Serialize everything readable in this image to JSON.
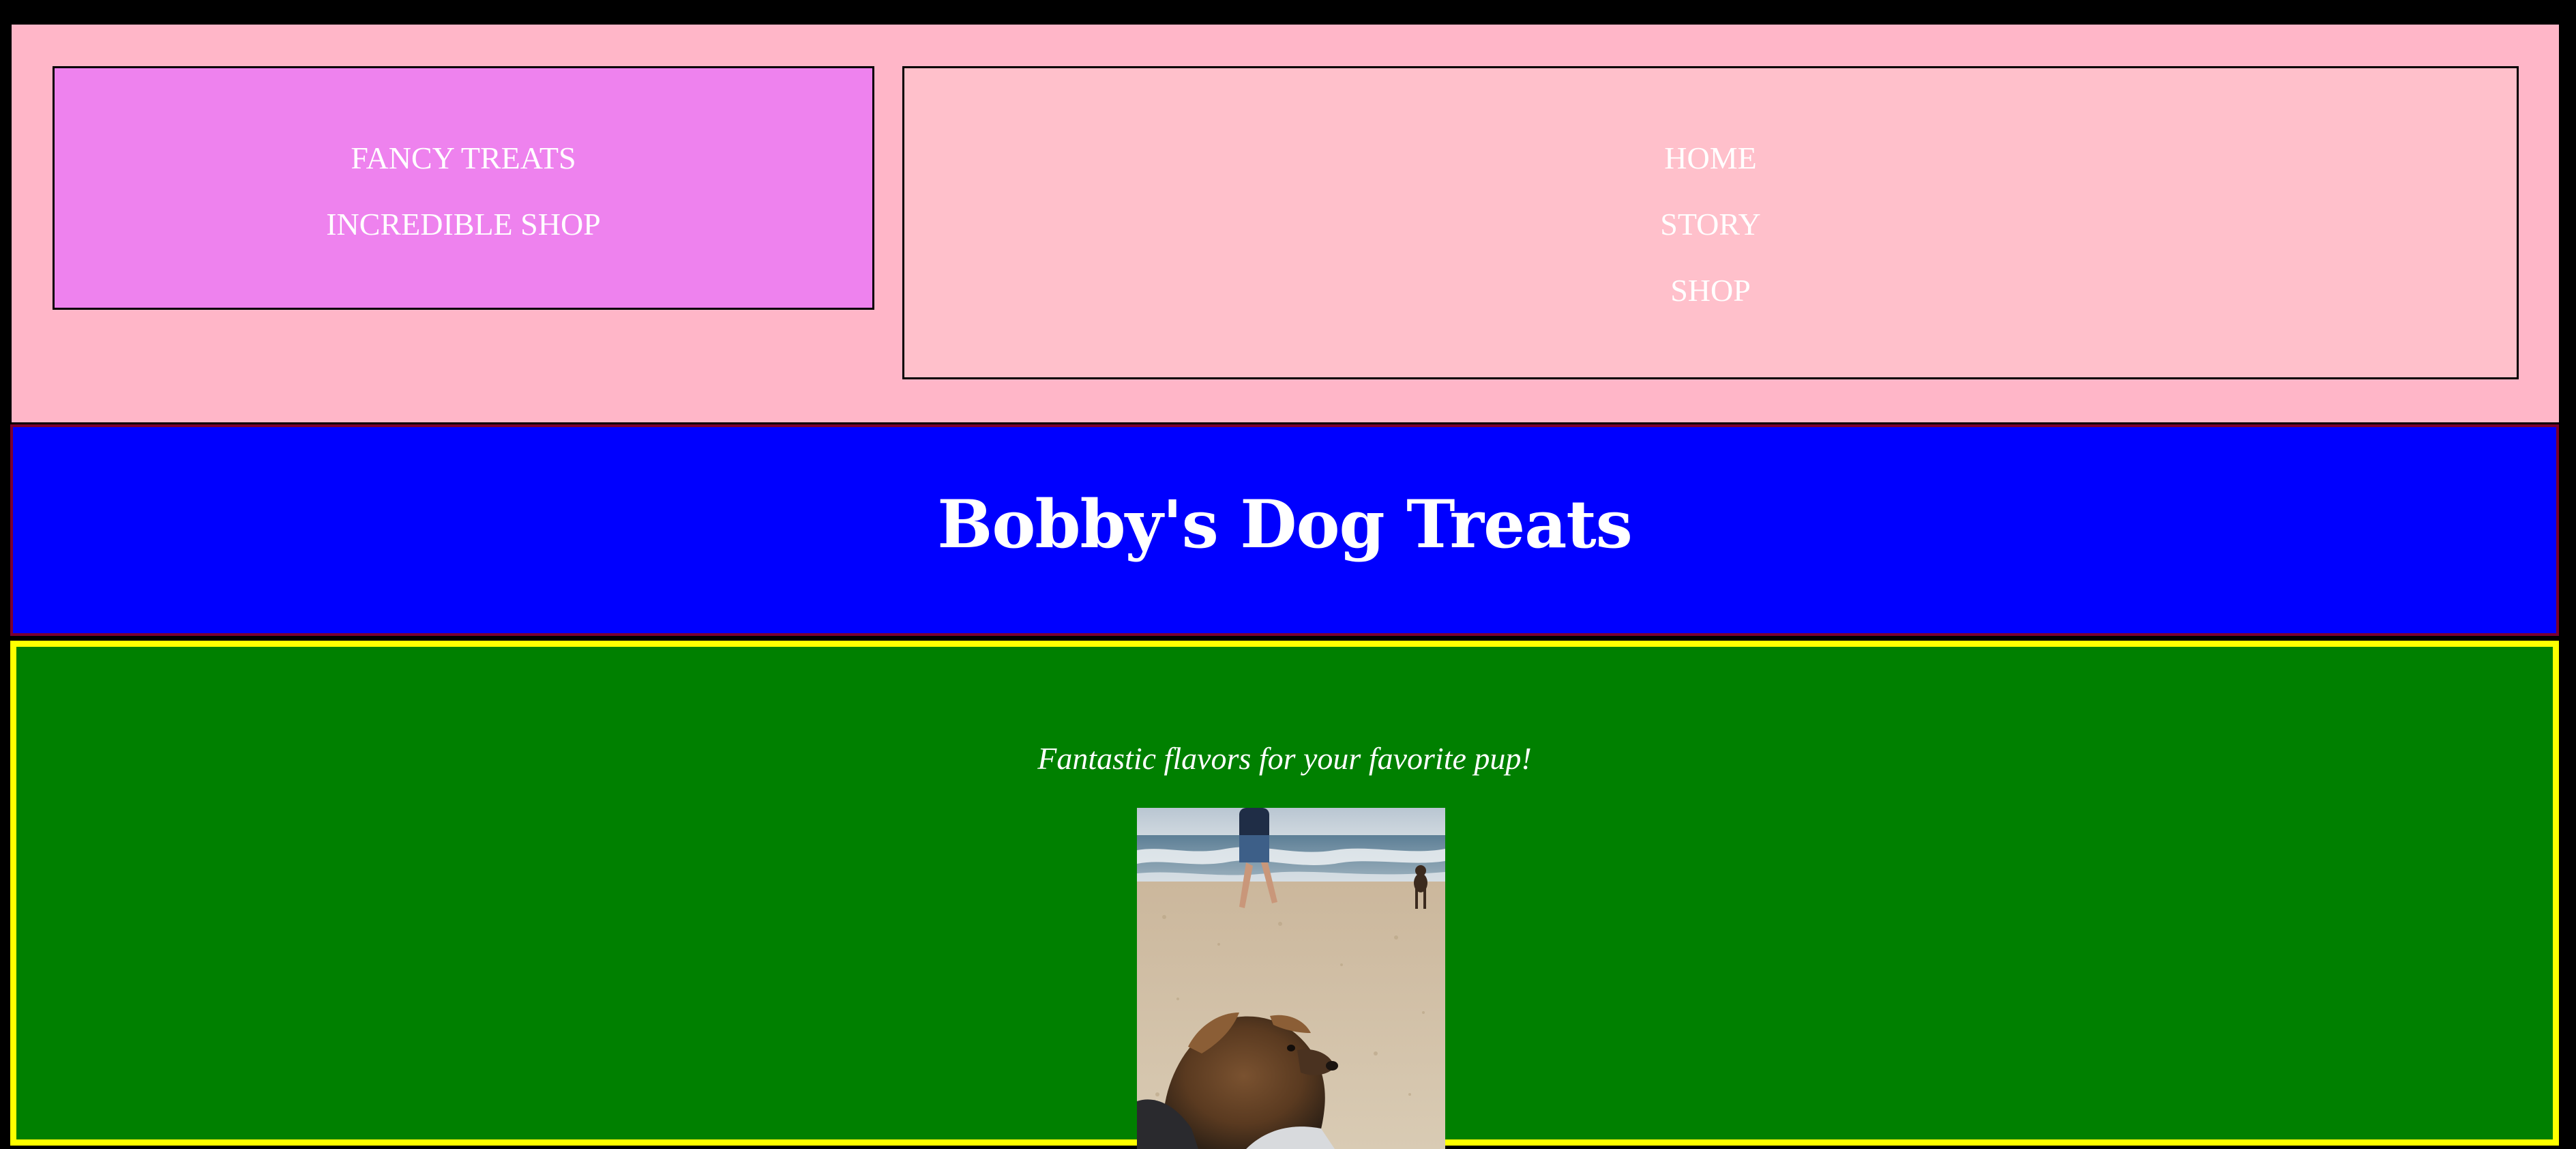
{
  "header": {
    "brand_lines": [
      "FANCY TREATS",
      "INCREDIBLE SHOP"
    ],
    "nav": [
      "HOME",
      "STORY",
      "SHOP"
    ]
  },
  "title": "Bobby's Dog Treats",
  "main": {
    "tagline": "Fantastic flavors for your favorite pup!",
    "photo_subject": "dog-on-beach-photo"
  },
  "colors": {
    "page_background": "#000000",
    "header_background": "#ffb6c8",
    "brand_box": "#ee82ee",
    "nav_box": "#ffc0cb",
    "title_band": "#0000ff",
    "main_background": "#008000",
    "main_border": "#ffff00",
    "text": "#ffffff"
  }
}
